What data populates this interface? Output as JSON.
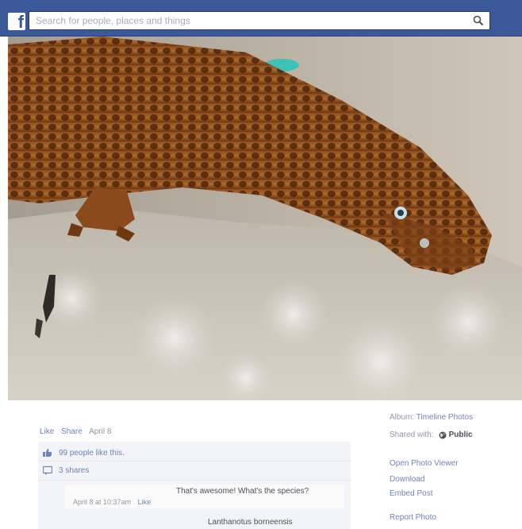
{
  "topbar": {
    "logo_letter": "f",
    "search": {
      "placeholder": "Search for people, places and things",
      "value": ""
    },
    "colors": {
      "bar": "#3b5998"
    },
    "icons": {
      "logo": "facebook-logo-icon",
      "search": "search-icon"
    }
  },
  "photo": {
    "subject": "lizard-photo"
  },
  "post": {
    "actions": {
      "like": "Like",
      "share": "Share",
      "date": "April 8"
    },
    "likes": {
      "icon": "thumbs-up-icon",
      "text": "99 people like this."
    },
    "shares": {
      "icon": "share-icon",
      "text": "3 shares"
    },
    "comments": [
      {
        "text": "That's awesome! What's the species?",
        "time": "April 8 at 10:37am",
        "like": "Like"
      },
      {
        "text": "Lanthanotus borneensis"
      }
    ]
  },
  "sidebar": {
    "album_prefix": "Album:",
    "album_name": "Timeline Photos",
    "shared_with_label": "Shared with:",
    "privacy_icon": "globe-icon",
    "shared_with_value": "Public",
    "links": {
      "open_photo_viewer": "Open Photo Viewer",
      "download": "Download",
      "embed_post": "Embed Post",
      "report_photo": "Report Photo"
    }
  }
}
